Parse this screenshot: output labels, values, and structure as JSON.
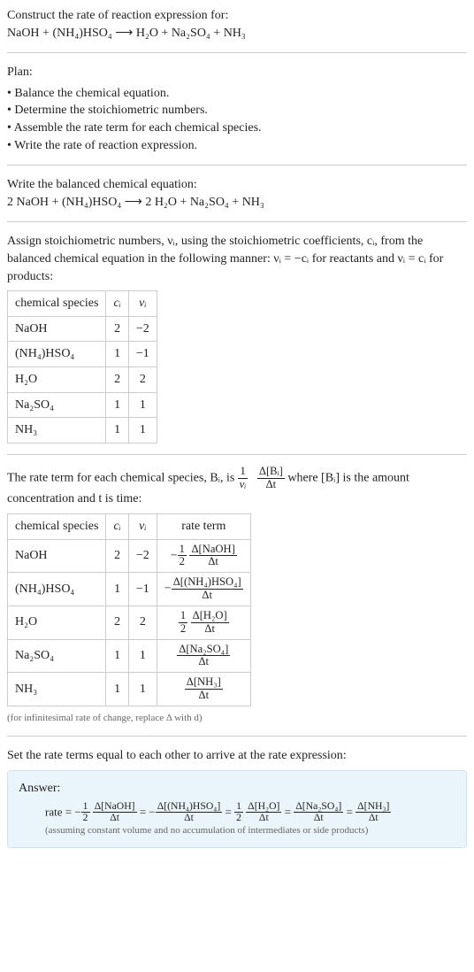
{
  "prompt_line1": "Construct the rate of reaction expression for:",
  "prompt_eq": "NaOH + (NH₄)HSO₄ ⟶ H₂O + Na₂SO₄ + NH₃",
  "plan_label": "Plan:",
  "plan_items": [
    "Balance the chemical equation.",
    "Determine the stoichiometric numbers.",
    "Assemble the rate term for each chemical species.",
    "Write the rate of reaction expression."
  ],
  "balanced_intro": "Write the balanced chemical equation:",
  "balanced_eq": "2 NaOH + (NH₄)HSO₄ ⟶ 2 H₂O + Na₂SO₄ + NH₃",
  "assign_text": "Assign stoichiometric numbers, νᵢ, using the stoichiometric coefficients, cᵢ, from the balanced chemical equation in the following manner: νᵢ = −cᵢ for reactants and νᵢ = cᵢ for products:",
  "table1": {
    "headers": [
      "chemical species",
      "cᵢ",
      "νᵢ"
    ],
    "rows": [
      [
        "NaOH",
        "2",
        "−2"
      ],
      [
        "(NH₄)HSO₄",
        "1",
        "−1"
      ],
      [
        "H₂O",
        "2",
        "2"
      ],
      [
        "Na₂SO₄",
        "1",
        "1"
      ],
      [
        "NH₃",
        "1",
        "1"
      ]
    ]
  },
  "rate_term_text_a": "The rate term for each chemical species, Bᵢ, is ",
  "rate_term_frac_num": "1",
  "rate_term_frac_den": "νᵢ",
  "rate_term_frac2_num": "Δ[Bᵢ]",
  "rate_term_frac2_den": "Δt",
  "rate_term_text_b": " where [Bᵢ] is the amount concentration and t is time:",
  "table2": {
    "headers": [
      "chemical species",
      "cᵢ",
      "νᵢ",
      "rate term"
    ],
    "rows": [
      {
        "sp": "NaOH",
        "c": "2",
        "v": "−2",
        "neg": "−",
        "half": true,
        "dnum": "Δ[NaOH]",
        "dden": "Δt"
      },
      {
        "sp": "(NH₄)HSO₄",
        "c": "1",
        "v": "−1",
        "neg": "−",
        "half": false,
        "dnum": "Δ[(NH₄)HSO₄]",
        "dden": "Δt"
      },
      {
        "sp": "H₂O",
        "c": "2",
        "v": "2",
        "neg": "",
        "half": true,
        "dnum": "Δ[H₂O]",
        "dden": "Δt"
      },
      {
        "sp": "Na₂SO₄",
        "c": "1",
        "v": "1",
        "neg": "",
        "half": false,
        "dnum": "Δ[Na₂SO₄]",
        "dden": "Δt"
      },
      {
        "sp": "NH₃",
        "c": "1",
        "v": "1",
        "neg": "",
        "half": false,
        "dnum": "Δ[NH₃]",
        "dden": "Δt"
      }
    ]
  },
  "infinitesimal_note": "(for infinitesimal rate of change, replace Δ with d)",
  "set_equal_text": "Set the rate terms equal to each other to arrive at the rate expression:",
  "answer_label": "Answer:",
  "rate_prefix": "rate = ",
  "terms": [
    {
      "neg": "−",
      "half": true,
      "num": "Δ[NaOH]",
      "den": "Δt"
    },
    {
      "neg": "−",
      "half": false,
      "num": "Δ[(NH₄)HSO₄]",
      "den": "Δt"
    },
    {
      "neg": "",
      "half": true,
      "num": "Δ[H₂O]",
      "den": "Δt"
    },
    {
      "neg": "",
      "half": false,
      "num": "Δ[Na₂SO₄]",
      "den": "Δt"
    },
    {
      "neg": "",
      "half": false,
      "num": "Δ[NH₃]",
      "den": "Δt"
    }
  ],
  "answer_note": "(assuming constant volume and no accumulation of intermediates or side products)"
}
